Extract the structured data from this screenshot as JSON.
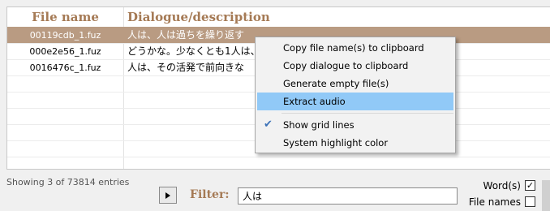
{
  "table": {
    "headers": [
      "File name",
      "Dialogue/description"
    ],
    "rows": [
      {
        "file": "00119cdb_1.fuz",
        "text": "人は、人は過ちを繰り返す"
      },
      {
        "file": "000e2e56_1.fuz",
        "text": "どうかな。少なくとも1人は、この"
      },
      {
        "file": "0016476c_1.fuz",
        "text": "人は、その活発で前向きな"
      }
    ]
  },
  "status": "Showing 3 of 73814 entries",
  "filter": {
    "label": "Filter:",
    "value": "人は"
  },
  "options": {
    "words": "Word(s)",
    "file_names": "File names"
  },
  "menu": {
    "copy_names": "Copy file name(s) to clipboard",
    "copy_dialogue": "Copy dialogue to clipboard",
    "generate": "Generate empty file(s)",
    "extract": "Extract audio",
    "grid_lines": "Show grid lines",
    "highlight": "System highlight color"
  },
  "colors": {
    "header_text": "#a57a55",
    "selected_row": "#b99b82",
    "menu_highlight": "#91c9f7"
  }
}
